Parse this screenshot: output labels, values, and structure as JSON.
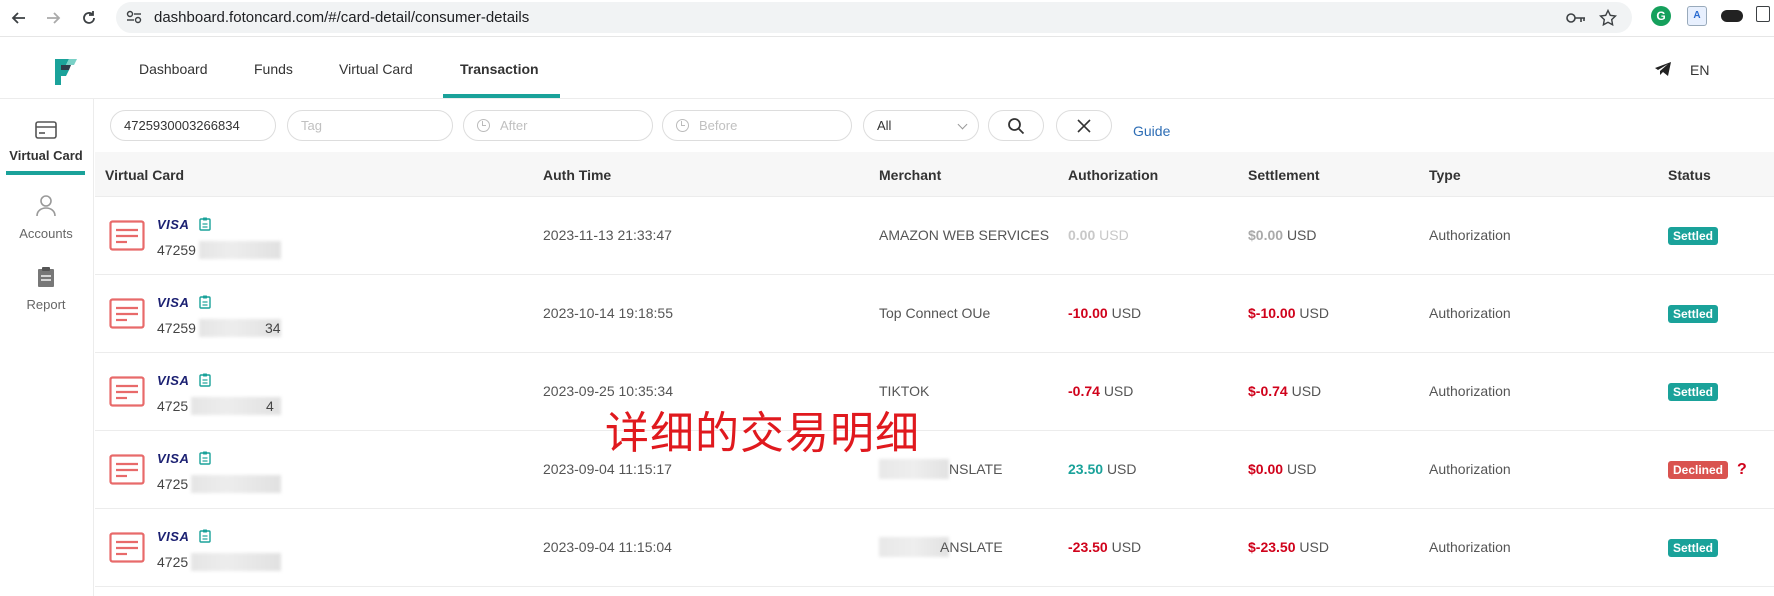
{
  "browser": {
    "url": "dashboard.fotoncard.com/#/card-detail/consumer-details"
  },
  "header": {
    "tabs": [
      {
        "label": "Dashboard"
      },
      {
        "label": "Funds"
      },
      {
        "label": "Virtual Card"
      },
      {
        "label": "Transaction"
      }
    ],
    "active_tab": "Transaction",
    "language": "EN"
  },
  "sidebar": {
    "items": [
      {
        "label": "Virtual Card",
        "icon": "card-icon"
      },
      {
        "label": "Accounts",
        "icon": "user-icon"
      },
      {
        "label": "Report",
        "icon": "clipboard-icon"
      }
    ]
  },
  "filters": {
    "card_number_value": "4725930003266834",
    "tag_placeholder": "Tag",
    "after_placeholder": "After",
    "before_placeholder": "Before",
    "status_select": "All",
    "guide_label": "Guide"
  },
  "table": {
    "columns": [
      "Virtual Card",
      "Auth Time",
      "Merchant",
      "Authorization",
      "Settlement",
      "Type",
      "Status"
    ],
    "rows": [
      {
        "brand": "VISA",
        "card_prefix": "47259",
        "auth_time": "2023-11-13 21:33:47",
        "merchant": "AMAZON WEB SERVICES",
        "merchant_blurred": false,
        "auth_amount": "0.00",
        "auth_currency": "USD",
        "auth_style": "zero",
        "settle_amount": "$0.00",
        "settle_currency": "USD",
        "settle_style": "zero",
        "type": "Authorization",
        "status": "Settled"
      },
      {
        "brand": "VISA",
        "card_prefix": "47259",
        "card_suffix": "34",
        "auth_time": "2023-10-14 19:18:55",
        "merchant": "Top Connect OUe",
        "merchant_blurred": false,
        "auth_amount": "-10.00",
        "auth_currency": "USD",
        "auth_style": "neg",
        "settle_amount": "$-10.00",
        "settle_currency": "USD",
        "settle_style": "neg",
        "type": "Authorization",
        "status": "Settled"
      },
      {
        "brand": "VISA",
        "card_prefix": "4725",
        "card_suffix": "4",
        "auth_time": "2023-09-25 10:35:34",
        "merchant": "TIKTOK",
        "merchant_blurred": false,
        "auth_amount": "-0.74",
        "auth_currency": "USD",
        "auth_style": "neg",
        "settle_amount": "$-0.74",
        "settle_currency": "USD",
        "settle_style": "neg",
        "type": "Authorization",
        "status": "Settled"
      },
      {
        "brand": "VISA",
        "card_prefix": "4725",
        "auth_time": "2023-09-04 11:15:17",
        "merchant": "NSLATE",
        "merchant_blurred": true,
        "auth_amount": "23.50",
        "auth_currency": "USD",
        "auth_style": "pos",
        "settle_amount": "$0.00",
        "settle_currency": "USD",
        "settle_style": "neg",
        "type": "Authorization",
        "status": "Declined",
        "help": "?"
      },
      {
        "brand": "VISA",
        "card_prefix": "4725",
        "auth_time": "2023-09-04 11:15:04",
        "merchant": "ANSLATE",
        "merchant_blurred": true,
        "auth_amount": "-23.50",
        "auth_currency": "USD",
        "auth_style": "neg",
        "settle_amount": "$-23.50",
        "settle_currency": "USD",
        "settle_style": "neg",
        "type": "Authorization",
        "status": "Settled"
      }
    ]
  },
  "overlay_text": "详细的交易明细",
  "colors": {
    "accent": "#1aa29a",
    "negative": "#d0021b",
    "declined": "#d9534f",
    "link": "#2d6db5"
  }
}
